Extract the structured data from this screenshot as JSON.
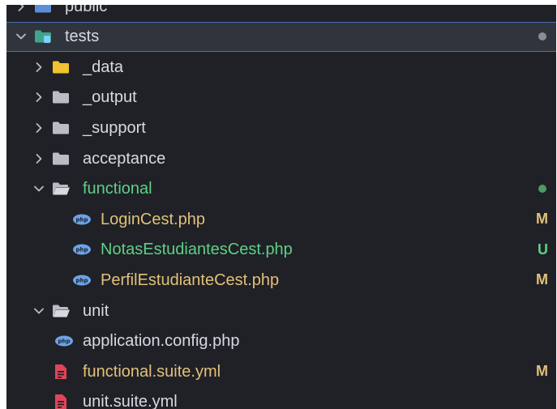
{
  "tree": {
    "rows": [
      {
        "name": "public",
        "kind": "folder",
        "icon": "folder-blue-icon",
        "depth": 0,
        "chevron": "right",
        "color": "#d7dae0"
      },
      {
        "name": "tests",
        "kind": "folder",
        "icon": "folder-test-icon",
        "depth": 0,
        "chevron": "down",
        "color": "#d7dae0",
        "selected": true,
        "dot": "#8a8d93"
      },
      {
        "name": "_data",
        "kind": "folder",
        "icon": "folder-yellow-icon",
        "depth": 1,
        "chevron": "right",
        "color": "#d7dae0"
      },
      {
        "name": "_output",
        "kind": "folder",
        "icon": "folder-icon",
        "depth": 1,
        "chevron": "right",
        "color": "#d7dae0"
      },
      {
        "name": "_support",
        "kind": "folder",
        "icon": "folder-icon",
        "depth": 1,
        "chevron": "right",
        "color": "#d7dae0"
      },
      {
        "name": "acceptance",
        "kind": "folder",
        "icon": "folder-icon",
        "depth": 1,
        "chevron": "right",
        "color": "#d7dae0"
      },
      {
        "name": "functional",
        "kind": "folder",
        "icon": "folder-open-icon",
        "depth": 1,
        "chevron": "down",
        "color": "#5fcf86",
        "dot": "#4c9a66"
      },
      {
        "name": "LoginCest.php",
        "kind": "php",
        "icon": "php-icon",
        "depth": 2,
        "color": "#e3c07a",
        "badge": "M",
        "badgeColor": "#e3c07a"
      },
      {
        "name": "NotasEstudiantesCest.php",
        "kind": "php",
        "icon": "php-icon",
        "depth": 2,
        "color": "#5fcf86",
        "badge": "U",
        "badgeColor": "#5fcf86"
      },
      {
        "name": "PerfilEstudianteCest.php",
        "kind": "php",
        "icon": "php-icon",
        "depth": 2,
        "color": "#e3c07a",
        "badge": "M",
        "badgeColor": "#e3c07a"
      },
      {
        "name": "unit",
        "kind": "folder",
        "icon": "folder-open-icon",
        "depth": 1,
        "chevron": "down",
        "color": "#d7dae0"
      },
      {
        "name": "application.config.php",
        "kind": "php",
        "icon": "php-icon",
        "depth": 1,
        "color": "#d7dae0"
      },
      {
        "name": "functional.suite.yml",
        "kind": "yml",
        "icon": "yml-file-icon",
        "depth": 1,
        "color": "#e3c07a",
        "badge": "M",
        "badgeColor": "#e3c07a"
      },
      {
        "name": "unit.suite.yml",
        "kind": "yml",
        "icon": "yml-file-icon",
        "depth": 1,
        "color": "#d7dae0"
      }
    ]
  }
}
